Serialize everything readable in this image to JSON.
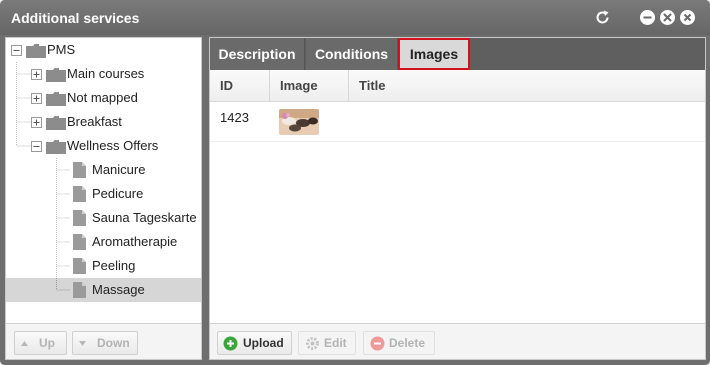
{
  "window": {
    "title": "Additional services",
    "controls": [
      "refresh-icon",
      "minimize-icon",
      "restore-icon",
      "close-icon"
    ]
  },
  "tree": {
    "root": {
      "label": "PMS",
      "icon": "folder-icon"
    },
    "items": [
      {
        "label": "Main courses",
        "type": "folder",
        "expanded": false
      },
      {
        "label": "Not mapped",
        "type": "folder",
        "expanded": false
      },
      {
        "label": "Breakfast",
        "type": "folder",
        "expanded": false
      },
      {
        "label": "Wellness Offers",
        "type": "folder",
        "expanded": true
      },
      {
        "label": "Manicure",
        "type": "leaf"
      },
      {
        "label": "Pedicure",
        "type": "leaf"
      },
      {
        "label": "Sauna Tageskarte",
        "type": "leaf"
      },
      {
        "label": "Aromatherapie",
        "type": "leaf"
      },
      {
        "label": "Peeling",
        "type": "leaf"
      },
      {
        "label": "Massage",
        "type": "leaf",
        "selected": true
      }
    ]
  },
  "left_toolbar": {
    "up_label": "Up",
    "down_label": "Down"
  },
  "tabs": [
    {
      "label": "Description",
      "active": false
    },
    {
      "label": "Conditions",
      "active": false
    },
    {
      "label": "Images",
      "active": true
    }
  ],
  "grid": {
    "columns": [
      "ID",
      "Image",
      "Title"
    ],
    "rows": [
      {
        "id": "1423",
        "image": "massage-stones-thumbnail",
        "title": ""
      }
    ]
  },
  "right_toolbar": {
    "upload_label": "Upload",
    "edit_label": "Edit",
    "delete_label": "Delete"
  },
  "colors": {
    "titlebar": "#6e6e6e",
    "tabbar": "#5f5f5f",
    "active_tab_border": "#d4111a",
    "selection": "#d6d6d6",
    "upload_icon": "#3aa63a",
    "delete_icon": "#e46a6a"
  }
}
